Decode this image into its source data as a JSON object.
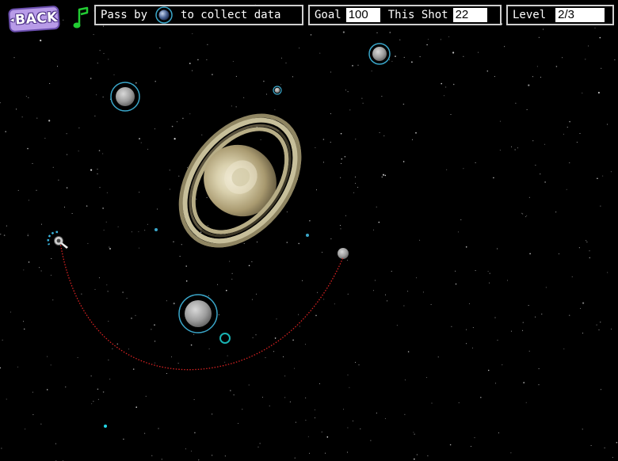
{
  "back_button": {
    "label": "BACK"
  },
  "music_toggle": {
    "icon": "music-note-icon",
    "color": "#22cc33"
  },
  "instruction": {
    "before": "Pass by",
    "icon": "moon-icon",
    "after": "to collect data"
  },
  "goal": {
    "label": "Goal",
    "value": "100"
  },
  "this_shot": {
    "label": "This Shot",
    "value": "22"
  },
  "level": {
    "label": "Level",
    "value": "2/3"
  },
  "colors": {
    "orbit_ring": "#3aa6c9",
    "trajectory": "#d82222",
    "target_ring": "#19b3b3",
    "space": "#000000"
  },
  "scene": {
    "planet": "saturn",
    "moons_with_orbit_rings": 4,
    "small_moons": 1,
    "probe": "spacecraft-icon"
  }
}
